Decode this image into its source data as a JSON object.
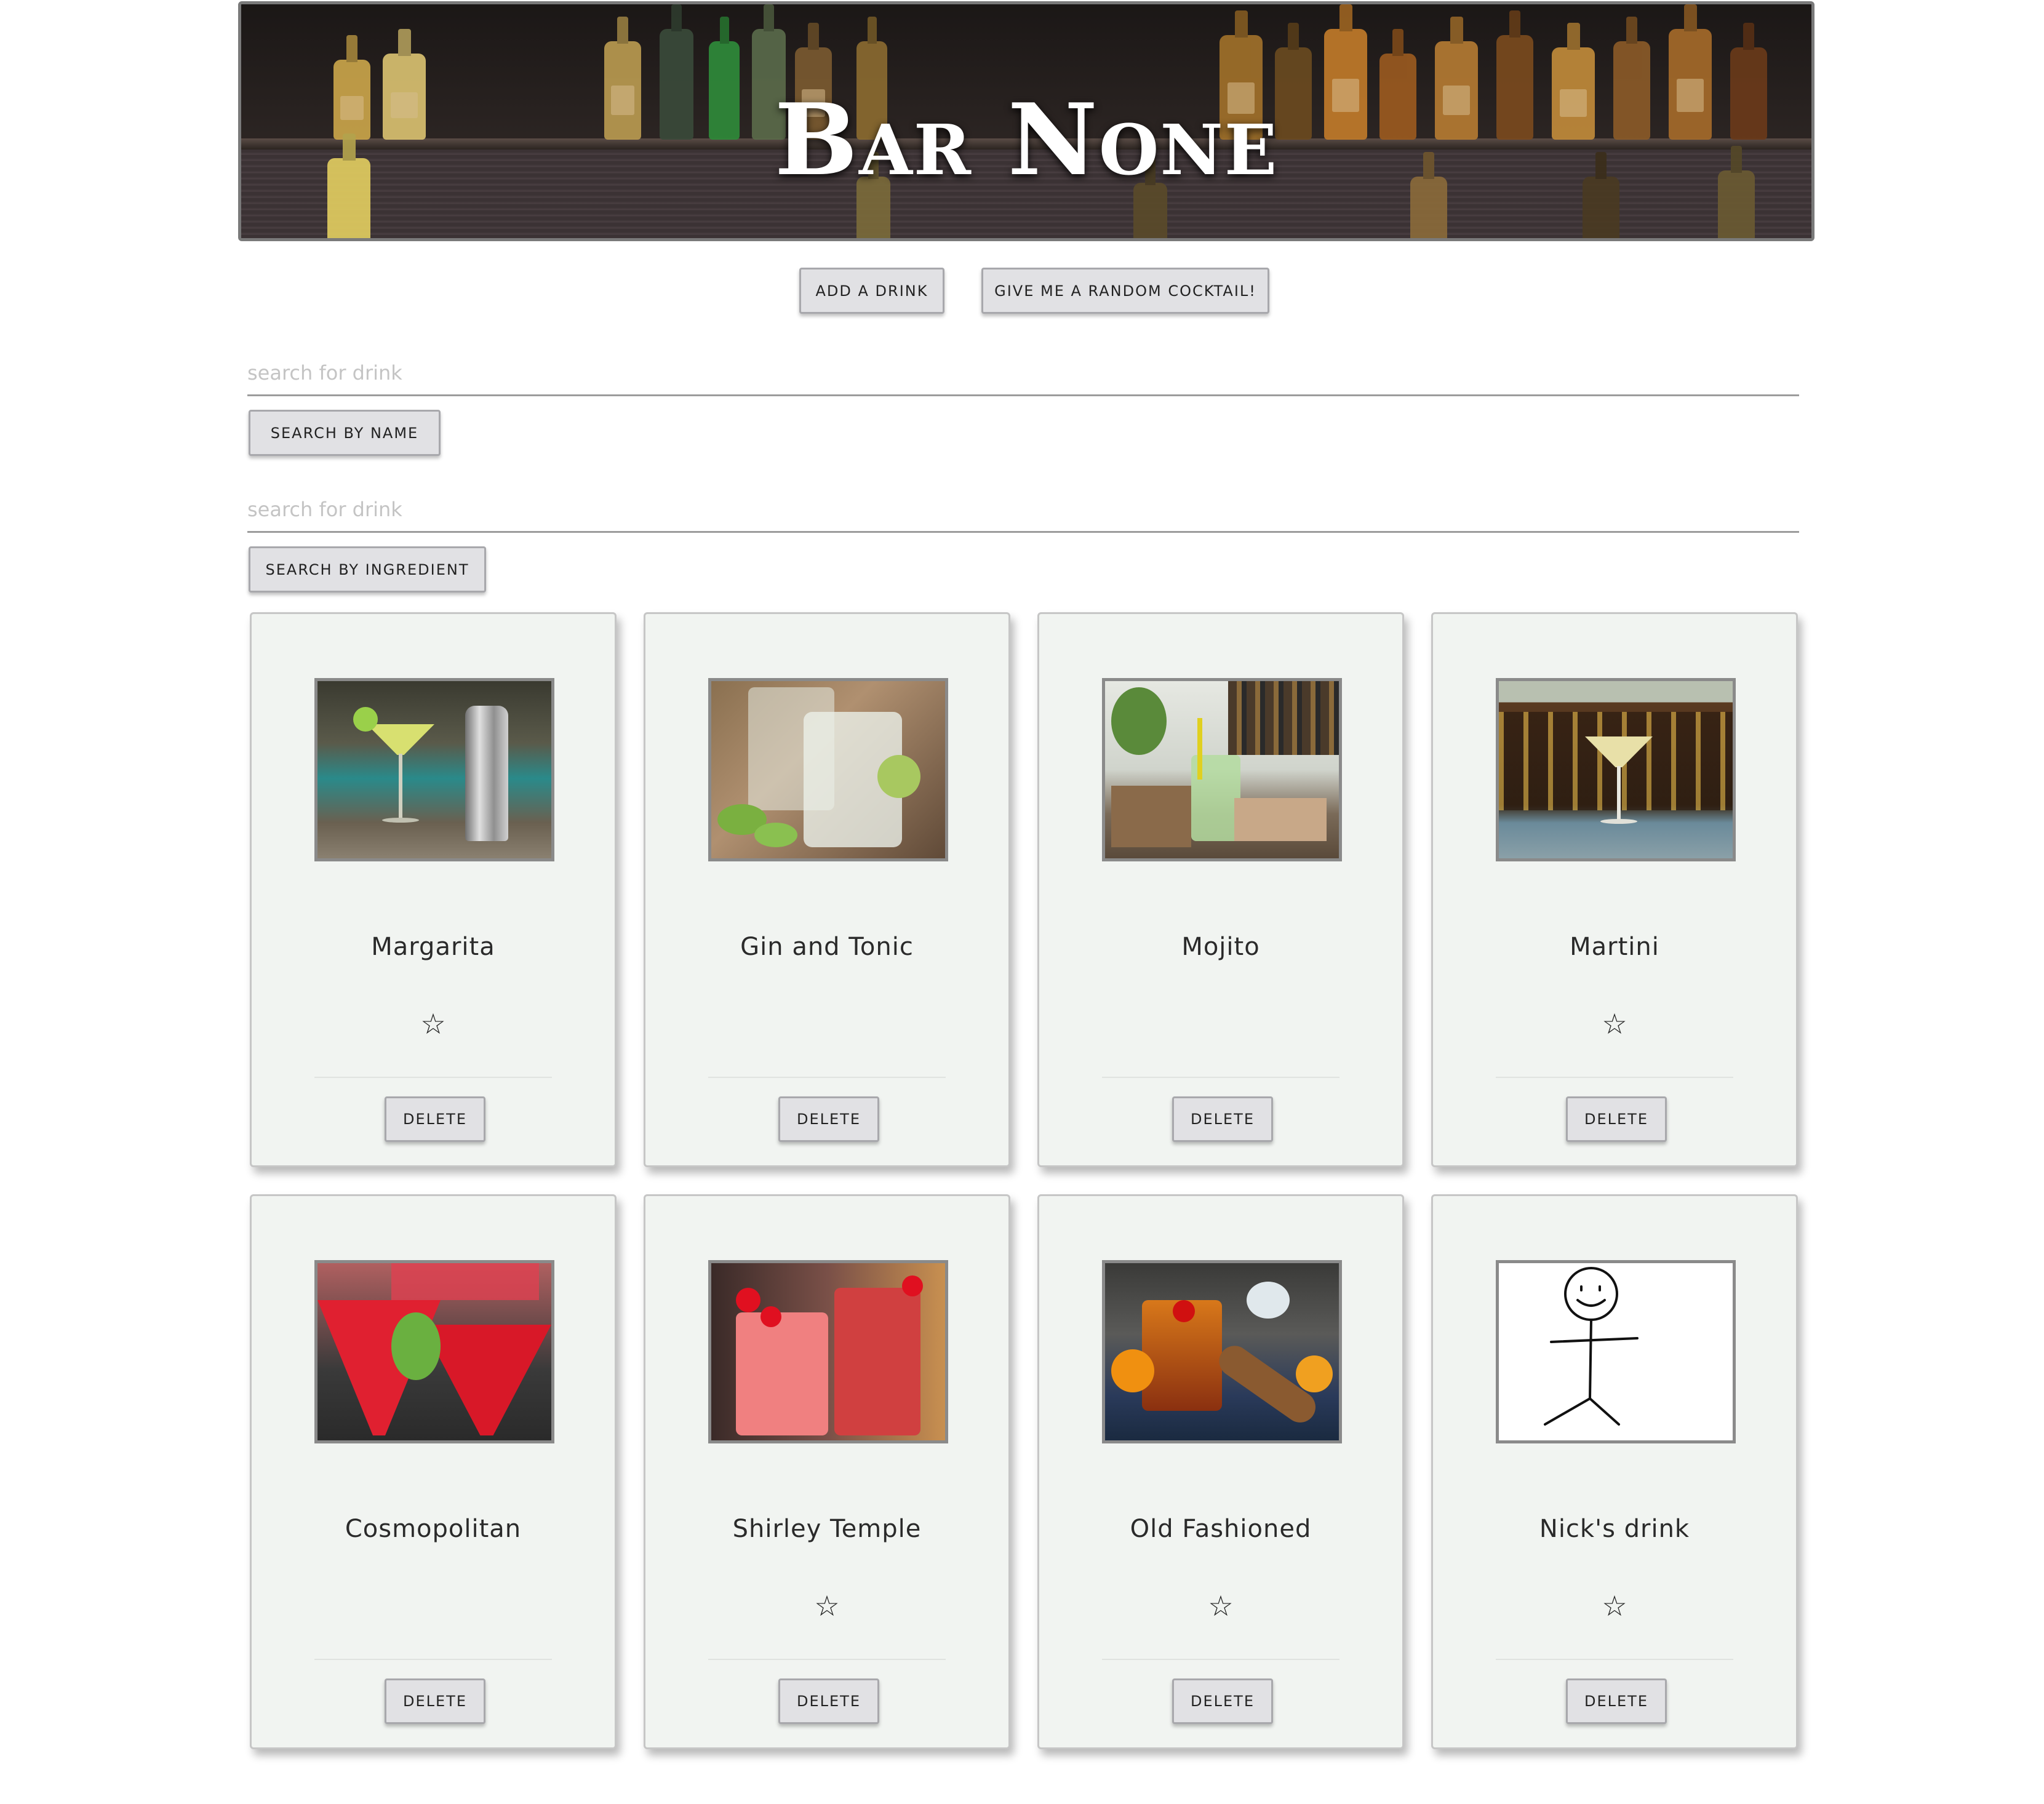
{
  "header": {
    "title": "Bar None"
  },
  "actions": {
    "add_label": "Add a drink",
    "random_label": "Give me a random cocktail!"
  },
  "search_name": {
    "placeholder": "search for drink",
    "button_label": "Search by name"
  },
  "search_ingredient": {
    "placeholder": "search for drink",
    "button_label": "Search by ingredient"
  },
  "drinks": [
    {
      "name": "Margarita",
      "favorite_icon": "star-outline-icon",
      "delete_label": "Delete",
      "image": "margarita-photo"
    },
    {
      "name": "Gin and Tonic",
      "delete_label": "Delete",
      "image": "gin-and-tonic-photo"
    },
    {
      "name": "Mojito",
      "delete_label": "Delete",
      "image": "mojito-photo"
    },
    {
      "name": "Martini",
      "favorite_icon": "star-outline-icon",
      "delete_label": "Delete",
      "image": "martini-photo"
    },
    {
      "name": "Cosmopolitan",
      "delete_label": "Delete",
      "image": "cosmopolitan-photo"
    },
    {
      "name": "Shirley Temple",
      "favorite_icon": "star-outline-icon",
      "delete_label": "Delete",
      "image": "shirley-temple-photo"
    },
    {
      "name": "Old Fashioned",
      "favorite_icon": "star-outline-icon",
      "delete_label": "Delete",
      "image": "old-fashioned-photo"
    },
    {
      "name": "Nick's drink",
      "favorite_icon": "star-outline-icon",
      "delete_label": "Delete",
      "image": "stick-figure-drawing"
    }
  ],
  "icons": {
    "star": "☆"
  },
  "colors": {
    "card_background": "#f1f4f1",
    "button_background": "#e1e1e4",
    "hero_background": "#2a2322"
  }
}
